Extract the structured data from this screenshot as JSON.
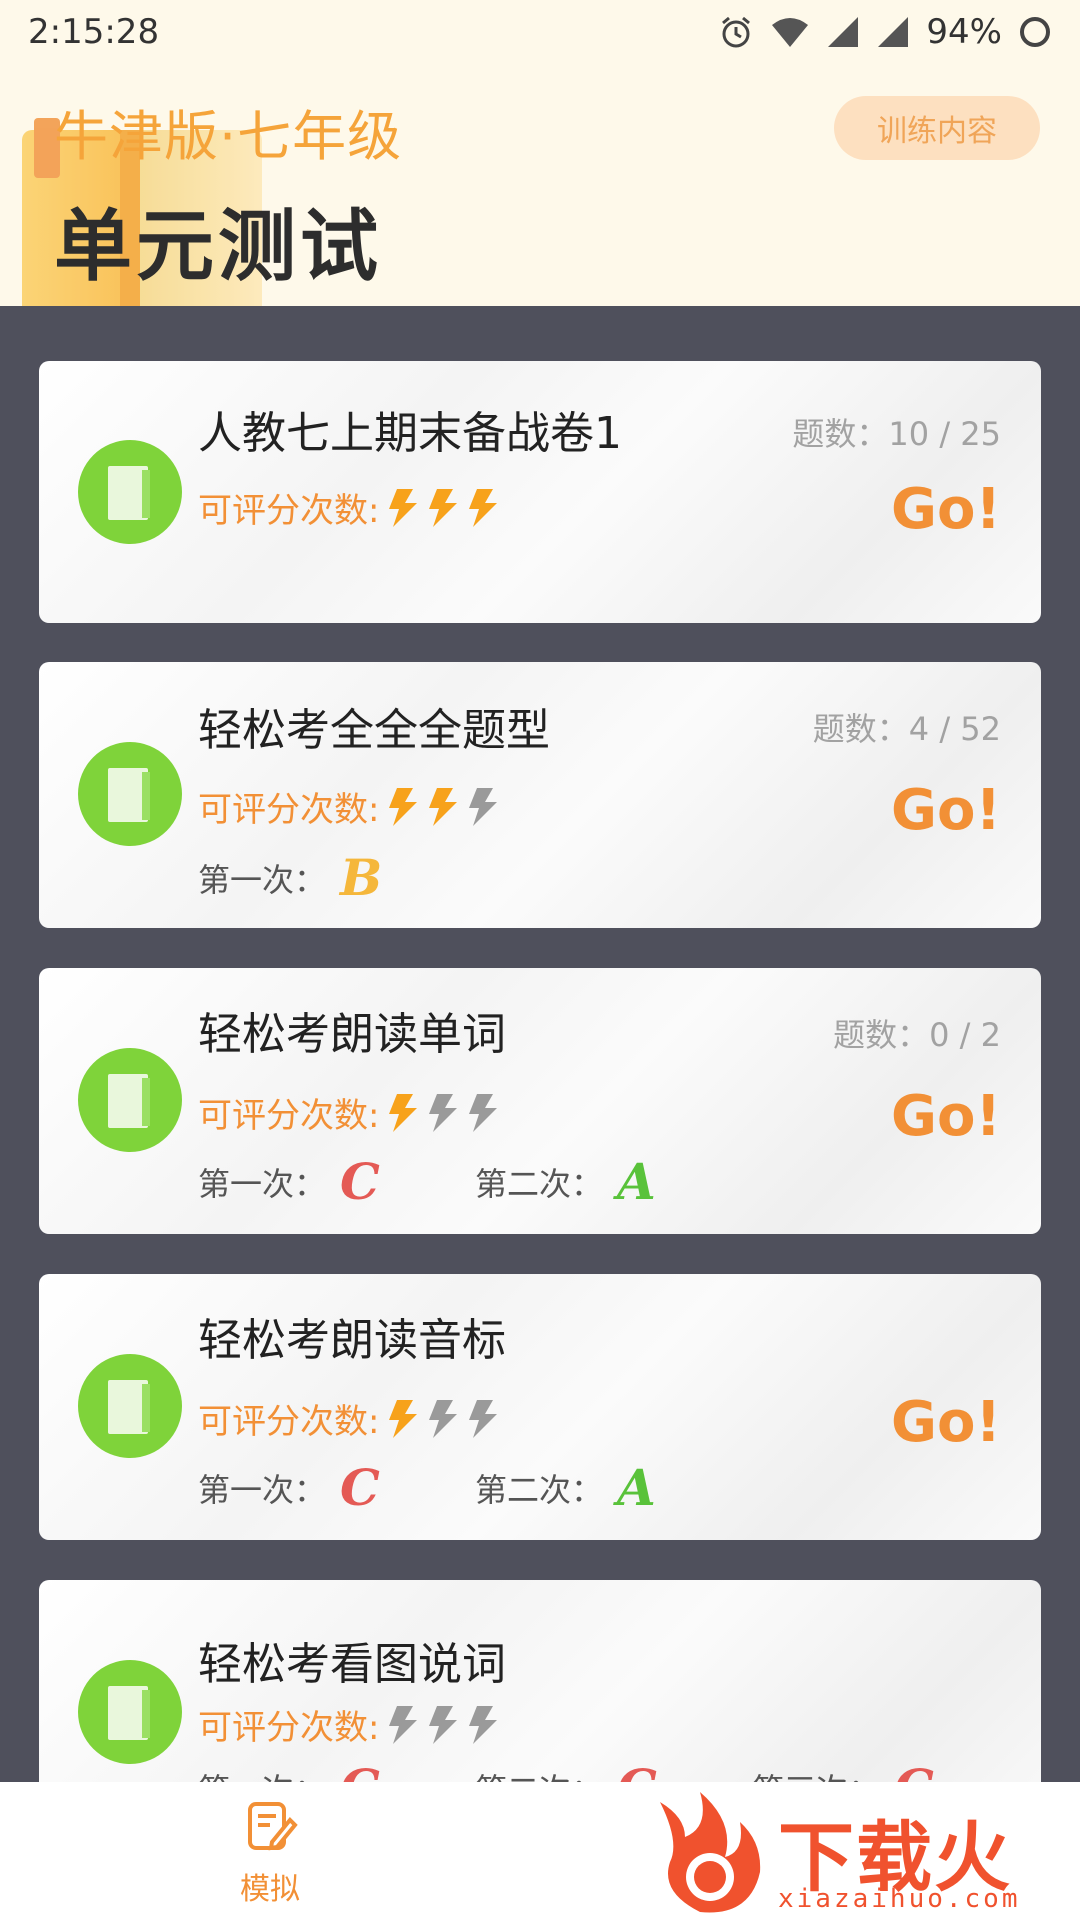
{
  "status": {
    "time": "2:15:28",
    "battery": "94%",
    "icons": [
      "alarm-icon",
      "wifi-icon",
      "signal-icon",
      "signal-icon",
      "battery-icon"
    ]
  },
  "header": {
    "subtitle": "牛津版·七年级",
    "title": "单元测试",
    "train_button": "训练内容"
  },
  "cards": [
    {
      "title": "人教七上期末备战卷1",
      "count": "题数：10 / 25",
      "go": "Go!",
      "score_label": "可评分次数:",
      "bolts_remaining": 3,
      "attempts": []
    },
    {
      "title": "轻松考全全全题型",
      "count": "题数：4 / 52",
      "go": "Go!",
      "score_label": "可评分次数:",
      "bolts_remaining": 2,
      "attempts": [
        {
          "label": "第一次：",
          "grade": "B",
          "color": "#f5b73b"
        }
      ]
    },
    {
      "title": "轻松考朗读单词",
      "count": "题数：0 / 2",
      "go": "Go!",
      "score_label": "可评分次数:",
      "bolts_remaining": 1,
      "attempts": [
        {
          "label": "第一次：",
          "grade": "C",
          "color": "#e45a55"
        },
        {
          "label": "第二次：",
          "grade": "A",
          "color": "#59c23a"
        }
      ]
    },
    {
      "title": "轻松考朗读音标",
      "count": "",
      "go": "Go!",
      "score_label": "可评分次数:",
      "bolts_remaining": 1,
      "attempts": [
        {
          "label": "第一次：",
          "grade": "C",
          "color": "#e45a55"
        },
        {
          "label": "第二次：",
          "grade": "A",
          "color": "#59c23a"
        }
      ]
    },
    {
      "title": "轻松考看图说词",
      "count": "",
      "go": "",
      "score_label": "可评分次数:",
      "bolts_remaining": 0,
      "attempts": [
        {
          "label": "第一次：",
          "grade": "C",
          "color": "#e45a55"
        },
        {
          "label": "第二次：",
          "grade": "C",
          "color": "#e45a55"
        },
        {
          "label": "第三次：",
          "grade": "C",
          "color": "#e45a55"
        }
      ]
    }
  ],
  "bottom_nav": {
    "item_label": "模拟",
    "item_icon": "edit-document-icon"
  },
  "watermark": {
    "text": "下载火",
    "url": "xiazaihuo.com"
  },
  "colors": {
    "accent": "#f29036",
    "header_bg": "#fef9ea",
    "list_bg": "#4f505c",
    "icon_green": "#7fd33a",
    "bolt_active": "#f7a21b",
    "bolt_inactive": "#9a9a9a"
  }
}
